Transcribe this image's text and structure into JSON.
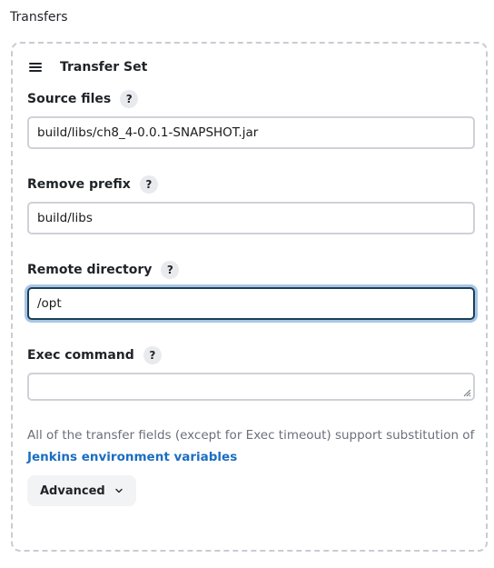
{
  "section": {
    "title": "Transfers"
  },
  "transfer_set": {
    "title": "Transfer Set",
    "fields": [
      {
        "label": "Source files",
        "help": "?",
        "value": "build/libs/ch8_4-0.0.1-SNAPSHOT.jar"
      },
      {
        "label": "Remove prefix",
        "help": "?",
        "value": "build/libs"
      },
      {
        "label": "Remote directory",
        "help": "?",
        "value": "/opt",
        "focused": true
      },
      {
        "label": "Exec command",
        "help": "?",
        "value": ""
      }
    ],
    "info_text": "All of the transfer fields (except for Exec timeout) support substitution of",
    "env_link": "Jenkins environment variables",
    "advanced_label": "Advanced"
  },
  "colors": {
    "link": "#1b6ec2",
    "focus_border": "#1c3f5a",
    "focus_ring": "#a9c6e4",
    "dashed_border": "#c9ccd3"
  },
  "icons": {
    "drag": "drag-handle-icon",
    "chevron": "chevron-down-icon"
  }
}
